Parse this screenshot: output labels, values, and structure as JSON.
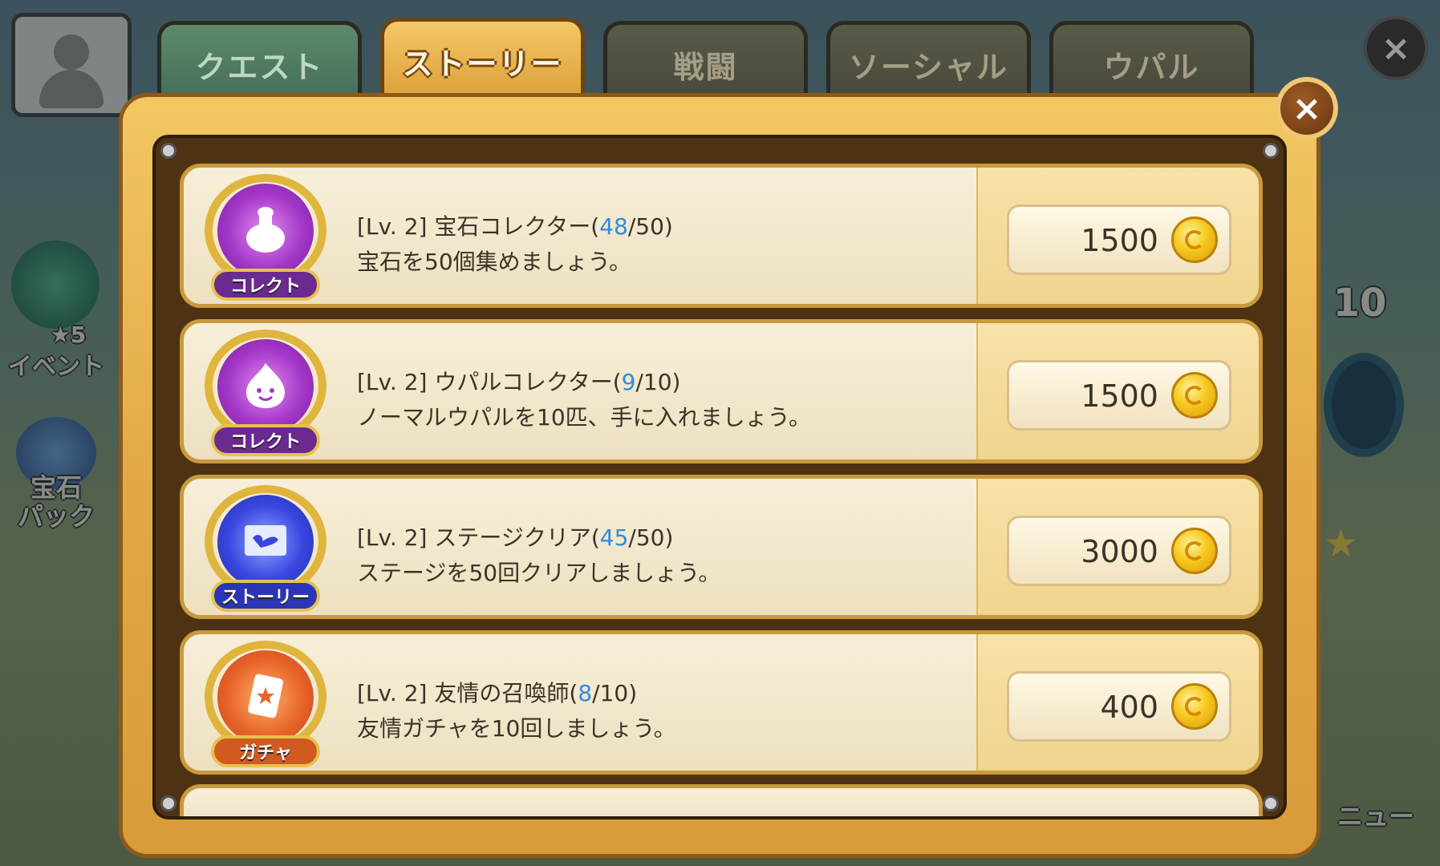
{
  "tabs": [
    {
      "label": "クエスト",
      "active": false
    },
    {
      "label": "ストーリー",
      "active": true
    },
    {
      "label": "戦闘",
      "active": false
    },
    {
      "label": "ソーシャル",
      "active": false
    },
    {
      "label": "ウパル",
      "active": false
    }
  ],
  "close_label": "×",
  "background": {
    "event_label": "イベント",
    "event_stars": "★5",
    "gem_pack_label": "宝石\nパック",
    "right_number": "10",
    "right_menu_label": "ニュー"
  },
  "quests": [
    {
      "level": "[Lv. 2]",
      "name": "宝石コレクター",
      "progress_current": "48",
      "progress_total": "/50)",
      "progress_open": "(",
      "description": "宝石を50個集めましょう。",
      "category": "コレクト",
      "category_color": "purple",
      "reward": "1500"
    },
    {
      "level": "[Lv. 2]",
      "name": "ウパルコレクター",
      "progress_current": "9",
      "progress_total": "/10)",
      "progress_open": "(",
      "description": "ノーマルウパルを10匹、手に入れましょう。",
      "category": "コレクト",
      "category_color": "purple",
      "reward": "1500"
    },
    {
      "level": "[Lv. 2]",
      "name": "ステージクリア",
      "progress_current": "45",
      "progress_total": "/50)",
      "progress_open": "(",
      "description": "ステージを50回クリアしましょう。",
      "category": "ストーリー",
      "category_color": "blue",
      "reward": "3000"
    },
    {
      "level": "[Lv. 2]",
      "name": "友情の召喚師",
      "progress_current": "8",
      "progress_total": "/10)",
      "progress_open": "(",
      "description": "友情ガチャを10回しましょう。",
      "category": "ガチャ",
      "category_color": "orange",
      "reward": "400"
    }
  ]
}
